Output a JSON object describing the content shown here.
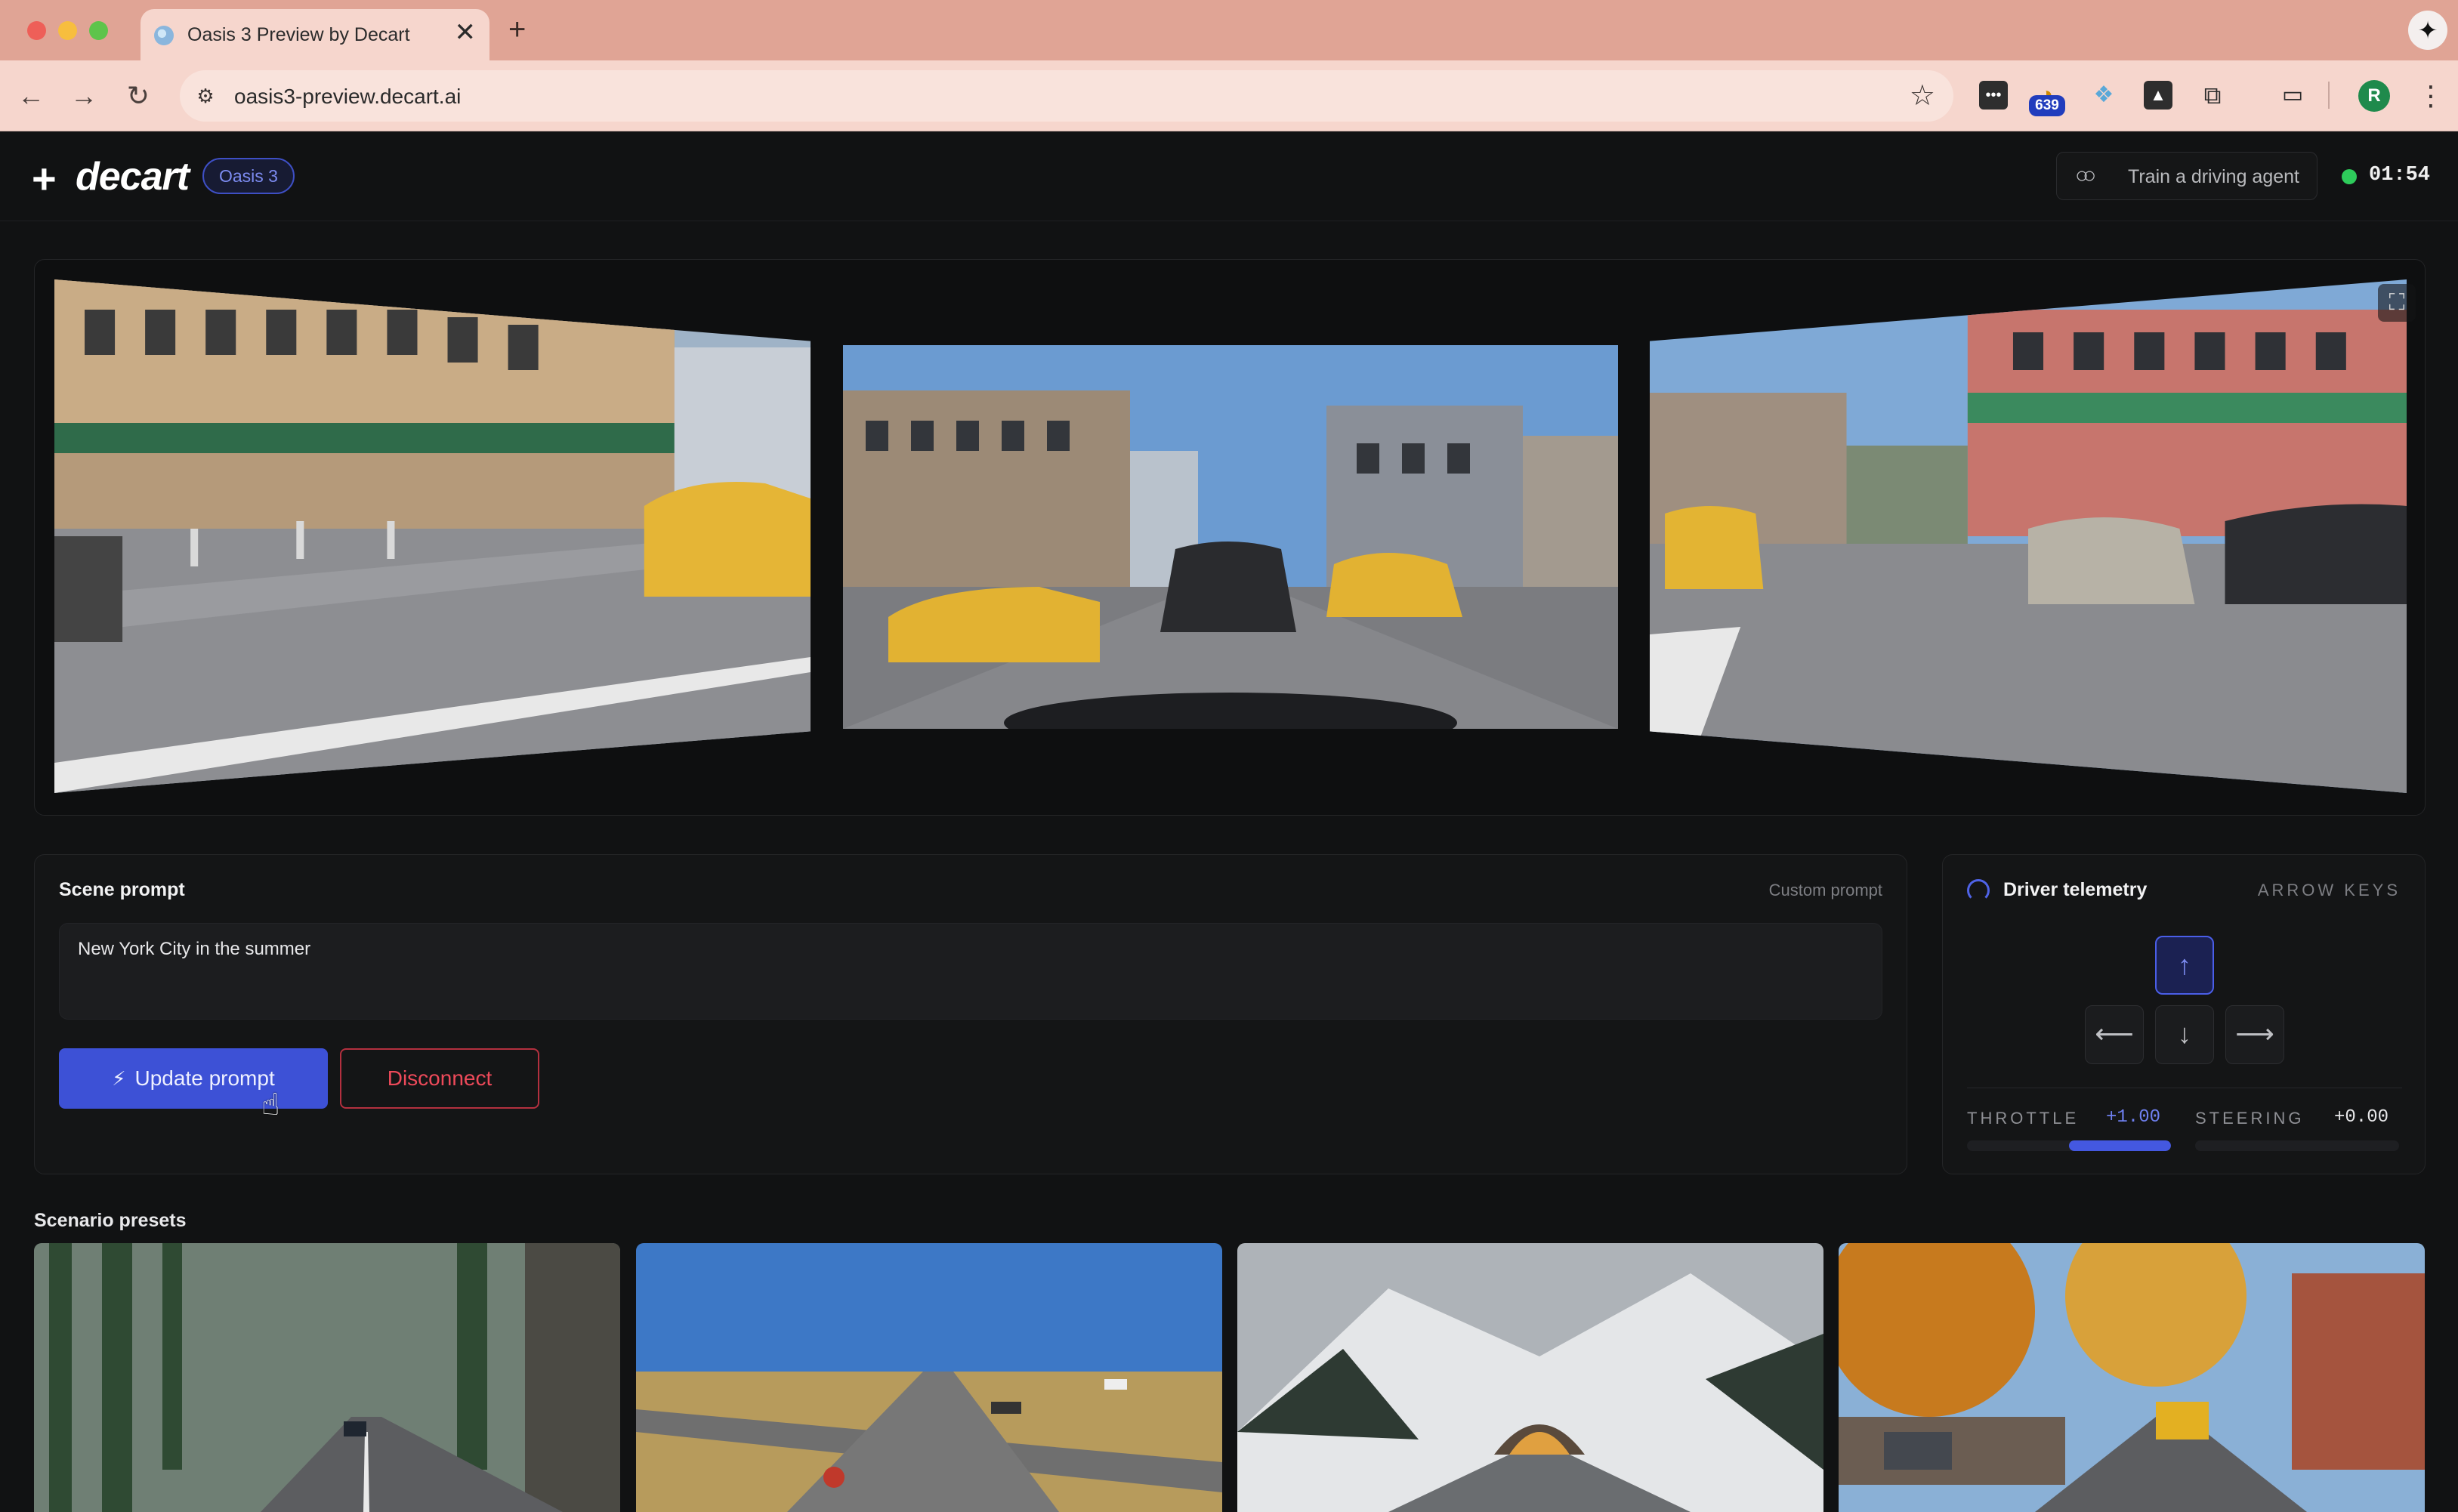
{
  "browser": {
    "tab_title": "Oasis 3 Preview by Decart",
    "tab_close": "✕",
    "new_tab": "+",
    "url": "oasis3-preview.decart.ai",
    "extension_badge": "639",
    "profile_initial": "R"
  },
  "header": {
    "logo_text": "decart",
    "model_badge": "Oasis 3",
    "train_button": "Train a driving agent",
    "timer": "01:54",
    "status_color": "#2ecc5b"
  },
  "viewer": {
    "cameras": [
      "left-camera",
      "front-camera",
      "right-camera"
    ],
    "fullscreen_icon": "⛶"
  },
  "prompt": {
    "title": "Scene prompt",
    "hint": "Custom prompt",
    "value": "New York City in the summer",
    "update_button": "Update prompt",
    "disconnect_button": "Disconnect"
  },
  "telemetry": {
    "title": "Driver telemetry",
    "hint": "ARROW KEYS",
    "keys": {
      "up": "↑",
      "left": "⟵",
      "down": "↓",
      "right": "⟶"
    },
    "active_key": "up",
    "throttle_label": "THROTTLE",
    "throttle_value": "+1.00",
    "throttle_level": 1.0,
    "steering_label": "STEERING",
    "steering_value": "+0.00",
    "steering_level": 0.0
  },
  "presets": {
    "title": "Scenario presets",
    "items": [
      "forest-road",
      "prairie-intersection",
      "snowy-mountain-tunnel",
      "autumn-suburb-street"
    ]
  },
  "colors": {
    "accent": "#3d51d6",
    "danger": "#ee4a5a",
    "background": "#111213"
  }
}
